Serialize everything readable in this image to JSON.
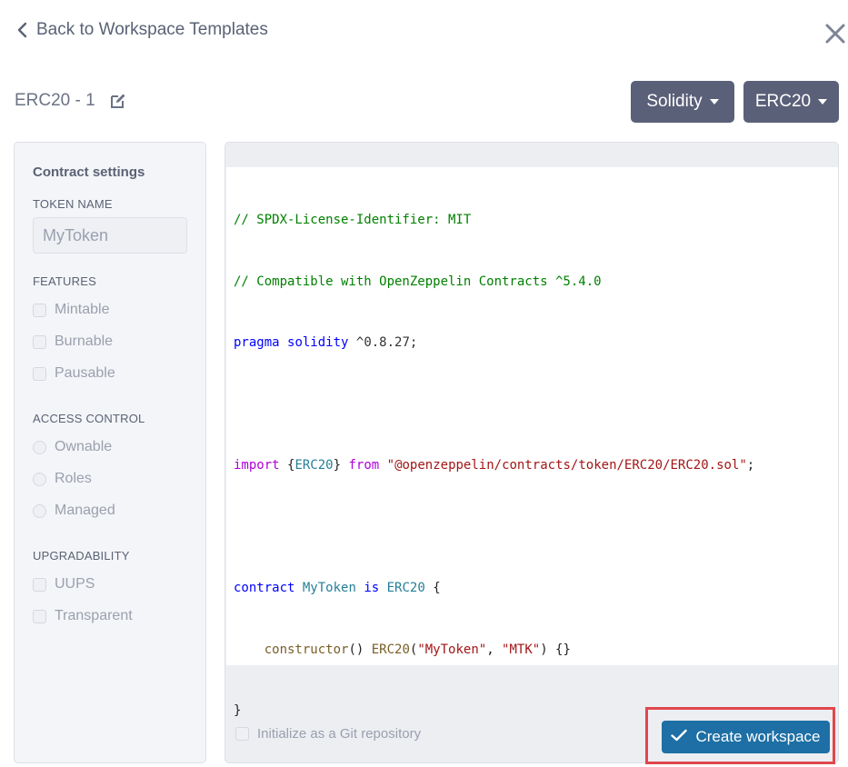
{
  "header": {
    "back_label": "Back to Workspace Templates",
    "close_icon": "close-icon"
  },
  "title": {
    "text": "ERC20 - 1",
    "edit_icon": "edit-icon"
  },
  "dropdowns": {
    "language": "Solidity",
    "template": "ERC20"
  },
  "sidebar": {
    "title": "Contract settings",
    "token_name_label": "TOKEN NAME",
    "token_name_value": "MyToken",
    "features_label": "FEATURES",
    "features": [
      "Mintable",
      "Burnable",
      "Pausable"
    ],
    "access_label": "ACCESS CONTROL",
    "access": [
      "Ownable",
      "Roles",
      "Managed"
    ],
    "upgrade_label": "UPGRADABILITY",
    "upgrade": [
      "UUPS",
      "Transparent"
    ]
  },
  "code": {
    "l1": "// SPDX-License-Identifier: MIT",
    "l2": "// Compatible with OpenZeppelin Contracts ^5.4.0",
    "l3_kw": "pragma",
    "l3_kw2": "solidity",
    "l3_ver": "^0.8.27;",
    "l5_import": "import",
    "l5_open": "{",
    "l5_name": "ERC20",
    "l5_close": "}",
    "l5_from": "from",
    "l5_path": "\"@openzeppelin/contracts/token/ERC20/ERC20.sol\"",
    "l5_semi": ";",
    "l7_contract": "contract",
    "l7_name": "MyToken",
    "l7_is": "is",
    "l7_base": "ERC20",
    "l7_brace": "{",
    "l8_indent": "    ",
    "l8_ctor": "constructor",
    "l8_parens": "()",
    "l8_base": "ERC20",
    "l8_open": "(",
    "l8_arg1": "\"MyToken\"",
    "l8_comma": ", ",
    "l8_arg2": "\"MTK\"",
    "l8_close": ") {}",
    "l9": "}"
  },
  "footer": {
    "git_label": "Initialize as a Git repository",
    "create_label": "Create workspace"
  },
  "colors": {
    "accent": "#1d6fa5",
    "dropdown_bg": "#5a6078",
    "highlight": "#e0474c"
  }
}
